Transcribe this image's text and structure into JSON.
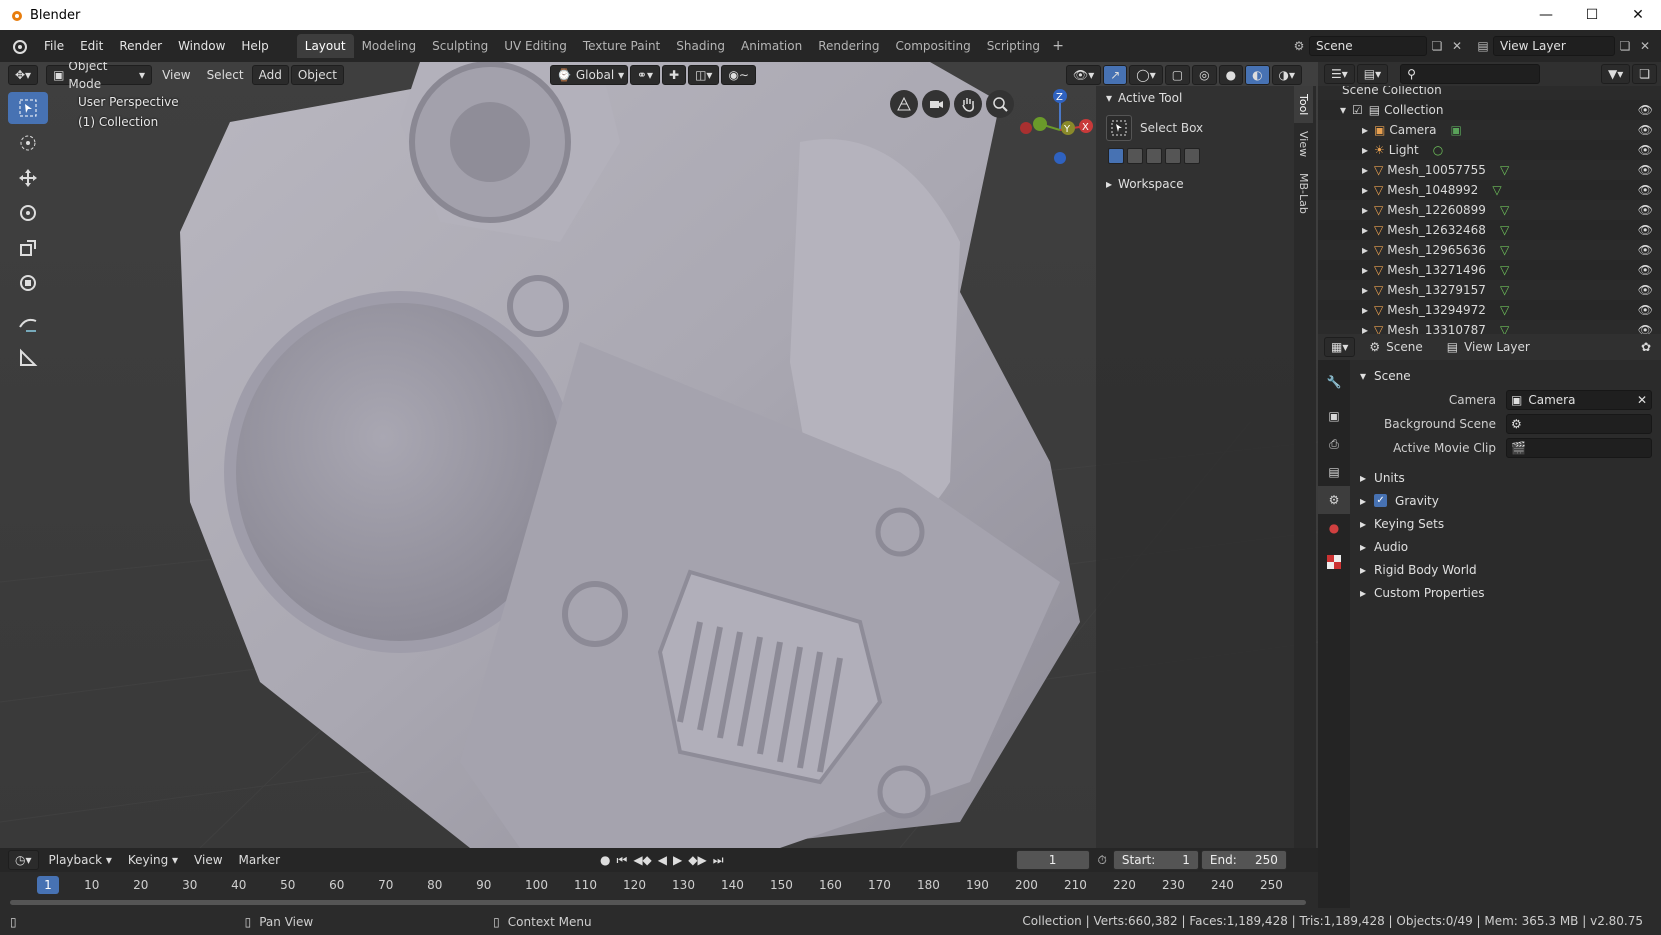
{
  "window": {
    "title": "Blender"
  },
  "menu": [
    "File",
    "Edit",
    "Render",
    "Window",
    "Help"
  ],
  "workspaces": [
    {
      "label": "Layout",
      "active": true
    },
    {
      "label": "Modeling"
    },
    {
      "label": "Sculpting"
    },
    {
      "label": "UV Editing"
    },
    {
      "label": "Texture Paint"
    },
    {
      "label": "Shading"
    },
    {
      "label": "Animation"
    },
    {
      "label": "Rendering"
    },
    {
      "label": "Compositing"
    },
    {
      "label": "Scripting"
    }
  ],
  "top_right": {
    "scene": "Scene",
    "view_layer": "View Layer"
  },
  "viewport": {
    "mode": "Object Mode",
    "menu": [
      "View",
      "Select",
      "Add",
      "Object"
    ],
    "transform_orientation": "Global",
    "info_line1": "User Perspective",
    "info_line2": "(1) Collection",
    "gizmo_axes": {
      "z": "Z",
      "y": "Y",
      "x": "X"
    }
  },
  "npanel": {
    "active_tool_header": "Active Tool",
    "tool_name": "Select Box",
    "workspace_header": "Workspace",
    "tabs": [
      "Tool",
      "View",
      "MB-Lab"
    ]
  },
  "outliner": {
    "top_item": "Scene Collection",
    "collection": "Collection",
    "items": [
      {
        "name": "Camera",
        "kind": "camera"
      },
      {
        "name": "Light",
        "kind": "light"
      },
      {
        "name": "Mesh_10057755",
        "kind": "mesh"
      },
      {
        "name": "Mesh_1048992",
        "kind": "mesh"
      },
      {
        "name": "Mesh_12260899",
        "kind": "mesh"
      },
      {
        "name": "Mesh_12632468",
        "kind": "mesh"
      },
      {
        "name": "Mesh_12965636",
        "kind": "mesh"
      },
      {
        "name": "Mesh_13271496",
        "kind": "mesh"
      },
      {
        "name": "Mesh_13279157",
        "kind": "mesh"
      },
      {
        "name": "Mesh_13294972",
        "kind": "mesh"
      },
      {
        "name": "Mesh_13310787",
        "kind": "mesh"
      }
    ]
  },
  "properties": {
    "breadcrumb_scene": "Scene",
    "breadcrumb_view_layer": "View Layer",
    "scene_panel": "Scene",
    "camera_label": "Camera",
    "camera_value": "Camera",
    "background_scene_label": "Background Scene",
    "active_movie_clip_label": "Active Movie Clip",
    "panels": [
      {
        "label": "Units"
      },
      {
        "label": "Gravity",
        "checkbox": true
      },
      {
        "label": "Keying Sets"
      },
      {
        "label": "Audio"
      },
      {
        "label": "Rigid Body World"
      },
      {
        "label": "Custom Properties"
      }
    ]
  },
  "timeline": {
    "menu": [
      "Playback",
      "Keying",
      "View",
      "Marker"
    ],
    "current_frame": "1",
    "start_label": "Start:",
    "start": "1",
    "end_label": "End:",
    "end": "250",
    "cursor_frame": "1",
    "ticks": [
      "10",
      "20",
      "30",
      "40",
      "50",
      "60",
      "70",
      "80",
      "90",
      "100",
      "110",
      "120",
      "130",
      "140",
      "150",
      "160",
      "170",
      "180",
      "190",
      "200",
      "210",
      "220",
      "230",
      "240",
      "250"
    ]
  },
  "statusbar": {
    "pan_view": "Pan View",
    "context_menu": "Context Menu",
    "stats": "Collection | Verts:660,382 | Faces:1,189,428 | Tris:1,189,428 | Objects:0/49 | Mem: 365.3 MB | v2.80.75"
  },
  "colors": {
    "accent": "#4772b3",
    "viewport_bg": "#3d3d3d",
    "panel_bg": "#2b2b2b"
  }
}
